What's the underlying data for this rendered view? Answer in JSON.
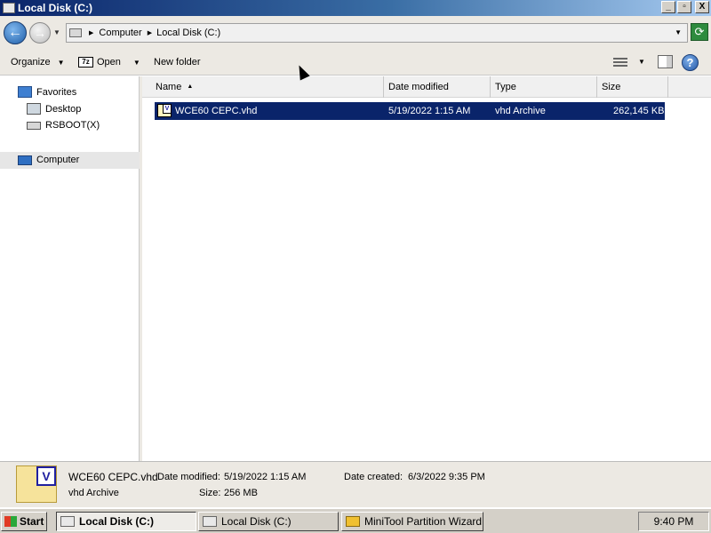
{
  "window": {
    "title": "Local Disk (C:)",
    "controls": {
      "minimize": "_",
      "maximize": "▫",
      "close": "X"
    }
  },
  "address_bar": {
    "crumbs": [
      "Computer",
      "Local Disk (C:)"
    ],
    "back_glyph": "←",
    "forward_glyph": "→",
    "refresh_glyph": "⟳"
  },
  "toolbar": {
    "organize_label": "Organize",
    "open_label": "Open",
    "open_icon_text": "7z",
    "new_folder_label": "New folder",
    "help_glyph": "?"
  },
  "nav_pane": {
    "items": [
      {
        "label": "Favorites",
        "icon": "favorites-star-icon"
      },
      {
        "label": "Desktop",
        "icon": "desktop-icon"
      },
      {
        "label": "RSBOOT(X)",
        "icon": "drive-icon"
      },
      {
        "label": "Computer",
        "icon": "computer-icon",
        "selected": true
      }
    ]
  },
  "columns": [
    {
      "label": "Name",
      "sorted": true
    },
    {
      "label": "Date modified"
    },
    {
      "label": "Type"
    },
    {
      "label": "Size"
    }
  ],
  "files": [
    {
      "name": "WCE60 CEPC.vhd",
      "date_modified": "5/19/2022 1:15 AM",
      "type": "vhd Archive",
      "size": "262,145 KB",
      "selected": true
    }
  ],
  "details_pane": {
    "filename": "WCE60 CEPC.vhd",
    "date_modified_label": "Date modified:",
    "date_modified": "5/19/2022 1:15 AM",
    "date_created_label": "Date created:",
    "date_created": "6/3/2022 9:35 PM",
    "type": "vhd Archive",
    "size_label": "Size:",
    "size": "256 MB",
    "badge": "V"
  },
  "taskbar": {
    "start_label": "Start",
    "buttons": [
      {
        "label": "Local Disk (C:)",
        "active": true
      },
      {
        "label": "Local Disk (C:)",
        "active": false
      },
      {
        "label": "MiniTool Partition Wizard ...",
        "active": false
      }
    ],
    "clock": "9:40 PM"
  },
  "colors": {
    "titlebar": "#0a246a",
    "selection": "#0a246a",
    "chrome": "#ece9e3"
  }
}
